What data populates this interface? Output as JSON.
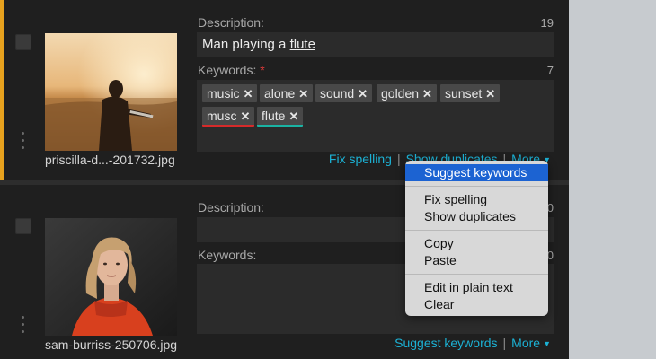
{
  "items": [
    {
      "filename": "priscilla-d...-201732.jpg",
      "description_label": "Description:",
      "description_count": "19",
      "description_prefix": "Man playing a ",
      "description_underlined": "flute",
      "keywords_label": "Keywords:",
      "keywords_required_mark": "*",
      "keywords_count": "7",
      "keywords": [
        {
          "text": "music",
          "remove_icon": "close-icon"
        },
        {
          "text": "alone",
          "remove_icon": "close-icon"
        },
        {
          "text": "sound",
          "remove_icon": "close-icon"
        },
        {
          "text": "golden",
          "remove_icon": "close-icon"
        },
        {
          "text": "sunset",
          "remove_icon": "close-icon"
        },
        {
          "text": "musc",
          "remove_icon": "close-icon",
          "status": "misspelled",
          "marker_color": "#d62a2a"
        },
        {
          "text": "flute",
          "remove_icon": "close-icon",
          "status": "duplicate",
          "marker_color": "#1ab3a3"
        }
      ],
      "actions": {
        "fix_spelling": "Fix spelling",
        "show_duplicates": "Show duplicates",
        "separator": "|",
        "more": "More",
        "more_icon": "caret-down-icon"
      },
      "accent_color": "#e7a21e"
    },
    {
      "filename": "sam-burriss-250706.jpg",
      "description_label": "Description:",
      "description_count": "0",
      "keywords_label": "Keywords:",
      "keywords_count": "0",
      "actions": {
        "suggest_keywords": "Suggest keywords",
        "separator": "|",
        "more": "More",
        "more_icon": "caret-down-icon"
      }
    }
  ],
  "context_menu": {
    "selected_color": "#1c63d2",
    "items": [
      "Suggest keywords",
      "Fix spelling",
      "Show duplicates",
      "Copy",
      "Paste",
      "Edit in plain text",
      "Clear"
    ],
    "selected": "Suggest keywords"
  },
  "colors": {
    "link": "#1cb1d4",
    "accent": "#e7a21e"
  }
}
